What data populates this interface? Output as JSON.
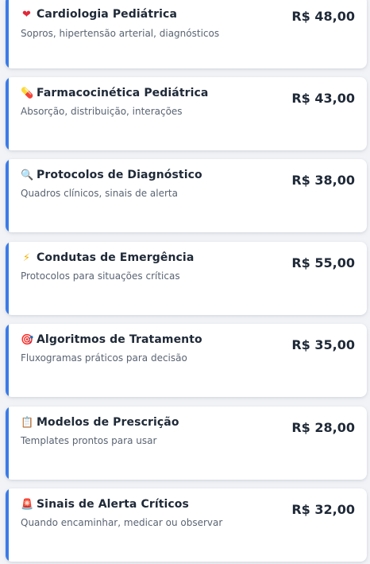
{
  "products": [
    {
      "icon": "heart-icon",
      "glyph": "❤",
      "title": "Cardiologia Pediátrica",
      "description": "Sopros, hipertensão arterial, diagnósticos",
      "price": "R$ 48,00"
    },
    {
      "icon": "pill-icon",
      "glyph": "💊",
      "title": "Farmacocinética Pediátrica",
      "description": "Absorção, distribuição, interações",
      "price": "R$ 43,00"
    },
    {
      "icon": "magnifier-icon",
      "glyph": "🔍",
      "title": "Protocolos de Diagnóstico",
      "description": "Quadros clínicos, sinais de alerta",
      "price": "R$ 38,00"
    },
    {
      "icon": "lightning-icon",
      "glyph": "⚡",
      "title": "Condutas de Emergência",
      "description": "Protocolos para situações críticas",
      "price": "R$ 55,00"
    },
    {
      "icon": "target-icon",
      "glyph": "🎯",
      "title": "Algoritmos de Tratamento",
      "description": "Fluxogramas práticos para decisão",
      "price": "R$ 35,00"
    },
    {
      "icon": "clipboard-icon",
      "glyph": "📋",
      "title": "Modelos de Prescrição",
      "description": "Templates prontos para usar",
      "price": "R$ 28,00"
    },
    {
      "icon": "siren-icon",
      "glyph": "🚨",
      "title": "Sinais de Alerta Críticos",
      "description": "Quando encaminhar, medicar ou observar",
      "price": "R$ 32,00"
    }
  ],
  "colors": {
    "accent": "#3b7be6",
    "card_background": "#ffffff",
    "page_background": "#f1f3f7",
    "title_text": "#1f2937",
    "description_text": "#5a6473"
  }
}
